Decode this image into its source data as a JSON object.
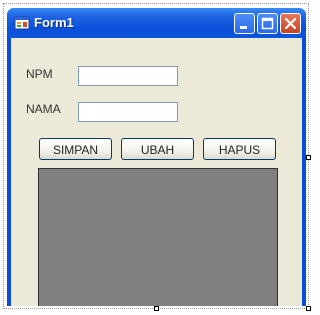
{
  "window": {
    "title": "Form1"
  },
  "icons": {
    "app": "form-icon",
    "minimize": "minimize-icon",
    "maximize": "maximize-icon",
    "close": "close-icon"
  },
  "form": {
    "npm_label": "NPM",
    "nama_label": "NAMA",
    "npm_value": "",
    "nama_value": ""
  },
  "buttons": {
    "simpan": "SIMPAN",
    "ubah": "UBAH",
    "hapus": "HAPUS"
  },
  "colors": {
    "titlebar": "#0a4fd8",
    "client": "#ece9d8",
    "grid": "#808080",
    "close": "#c4421f"
  }
}
